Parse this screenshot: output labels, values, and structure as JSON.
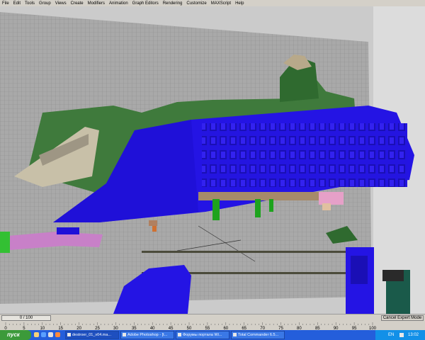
{
  "menu": {
    "items": [
      "File",
      "Edit",
      "Tools",
      "Group",
      "Views",
      "Create",
      "Modifiers",
      "Animation",
      "Graph Editors",
      "Rendering",
      "Customize",
      "MAXScript",
      "Help"
    ]
  },
  "timeline": {
    "frame_slider": "0 / 100",
    "expert_button": "Cancel Expert Mode"
  },
  "trackbar": {
    "ticks": [
      "0",
      "5",
      "10",
      "15",
      "20",
      "25",
      "30",
      "35",
      "40",
      "45",
      "50",
      "55",
      "60",
      "65",
      "70",
      "75",
      "80",
      "85",
      "90",
      "95",
      "100"
    ]
  },
  "taskbar": {
    "start_label": "пуск",
    "tasks": [
      {
        "label": "destroer_01_v04.ma...",
        "active": true
      },
      {
        "label": "Adobe Photoshop - [t...",
        "active": false
      },
      {
        "label": "Форумы портала Wi...",
        "active": false
      },
      {
        "label": "Total Commander 6.5...",
        "active": false
      }
    ],
    "language": "EN",
    "clock": "13:02"
  },
  "colors": {
    "model": "#1f12e6",
    "menubar": "#d4d0c8",
    "taskbar": "#245edb",
    "start": "#3c9a3a"
  }
}
